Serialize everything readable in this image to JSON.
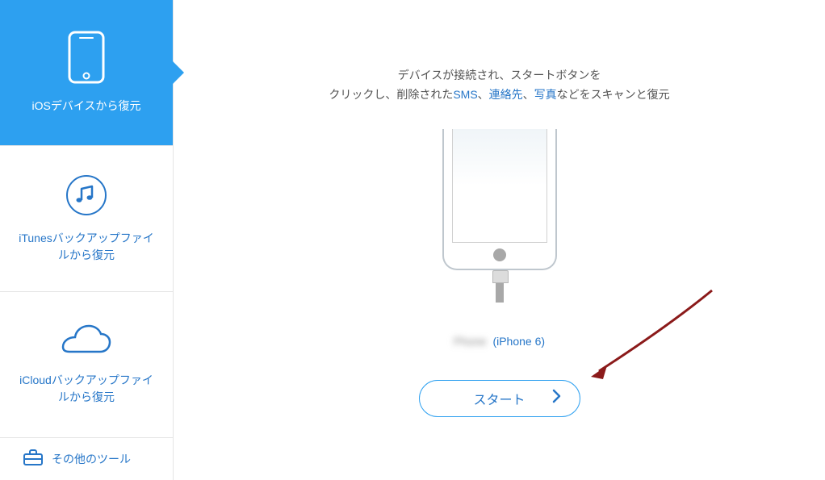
{
  "sidebar": {
    "items": [
      {
        "label": "iOSデバイスから復元"
      },
      {
        "label": "iTunesバックアップファイルから復元"
      },
      {
        "label": "iCloudバックアップファイルから復元"
      }
    ],
    "footer": {
      "label": "その他のツール"
    }
  },
  "main": {
    "instruction_line1": "デバイスが接続され、スタートボタンを",
    "instruction_line2_pre": "クリックし、削除された",
    "instruction_highlight1": "SMS",
    "instruction_sep1": "、",
    "instruction_highlight2": "連絡先",
    "instruction_sep2": "、",
    "instruction_highlight3": "写真",
    "instruction_line2_post": "などをスキャンと復元",
    "device_name": "Phone",
    "device_model": "(iPhone 6)",
    "start_button": "スタート"
  }
}
